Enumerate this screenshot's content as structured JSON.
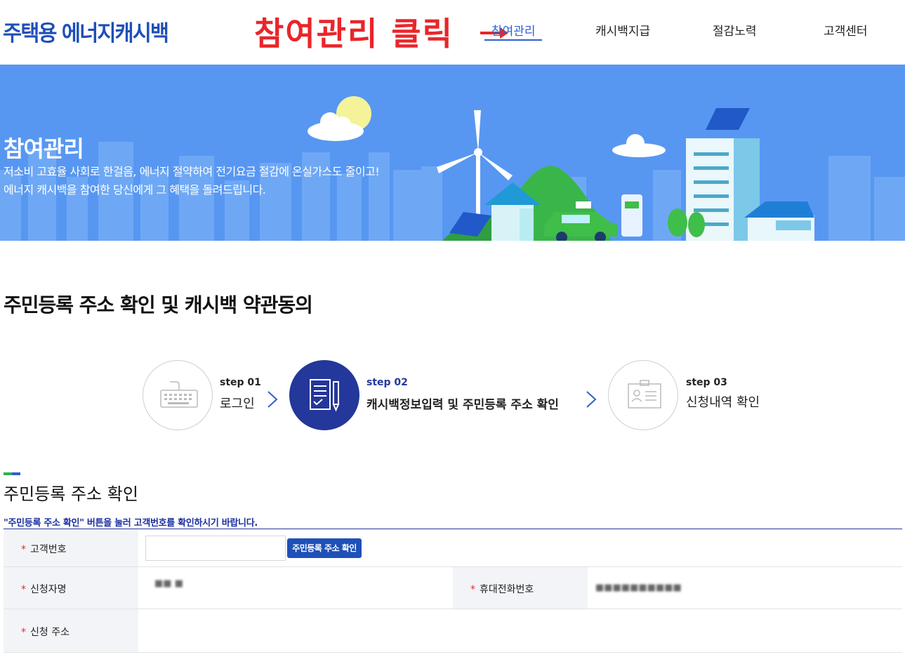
{
  "header": {
    "logo": "주택용 에너지캐시백",
    "annotation": "참여관리 클릭",
    "nav": [
      "참여관리",
      "캐시백지급",
      "절감노력",
      "고객센터"
    ]
  },
  "banner": {
    "title": "참여관리",
    "desc_line1": "저소비 고효율 사회로 한걸음, 에너지 절약하여 전기요금 절감에 온실가스도 줄이고!",
    "desc_line2": "에너지 캐시백을 참여한 당신에게 그 혜택을 돌려드립니다."
  },
  "page_title": "주민등록 주소 확인 및 캐시백 약관동의",
  "steps": [
    {
      "num": "step 01",
      "label": "로그인"
    },
    {
      "num": "step 02",
      "label": "캐시백정보입력 및 주민등록 주소 확인"
    },
    {
      "num": "step 03",
      "label": "신청내역 확인"
    }
  ],
  "section": {
    "title": "주민등록 주소 확인",
    "notice": "\"주민등록 주소 확인\" 버튼을 눌러 고객번호를 확인하시기 바랍니다."
  },
  "form": {
    "customer_no_label": "고객번호",
    "customer_no_value": "",
    "confirm_button": "주민등록 주소 확인",
    "applicant_label": "신청자명",
    "applicant_value": "■■ ■",
    "phone_label": "휴대전화번호",
    "phone_value": "■■■■■■■■■■",
    "address_label": "신청 주소",
    "address_value": ""
  },
  "colors": {
    "brand": "#1f4fb8",
    "accent_red": "#e8262a",
    "step_active": "#24379a",
    "banner": "#5797f2"
  }
}
